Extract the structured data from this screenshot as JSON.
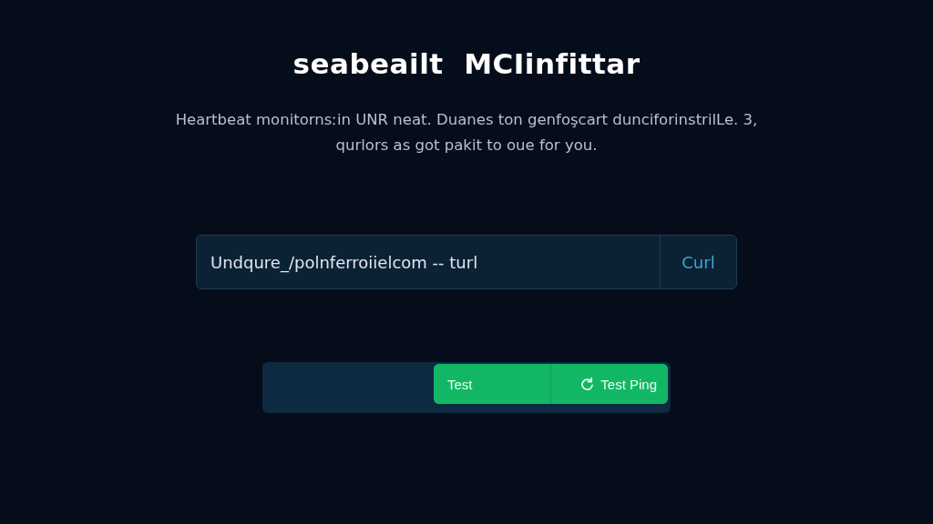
{
  "title": "seabeailt  MCIinfittar",
  "description": "Heartbeat monitornsːin UNR neat. Duanes ton genfoşcart dunciforinstrilLe. 3, qurlors as got pakit to oue for you.",
  "url_field": {
    "value": "Undqure_/polnferroiielcom -- turl",
    "button": "Curl"
  },
  "actions": [
    {
      "label": "Test",
      "kind": "plain"
    },
    {
      "label": "Test Ping",
      "kind": "iconic"
    }
  ]
}
